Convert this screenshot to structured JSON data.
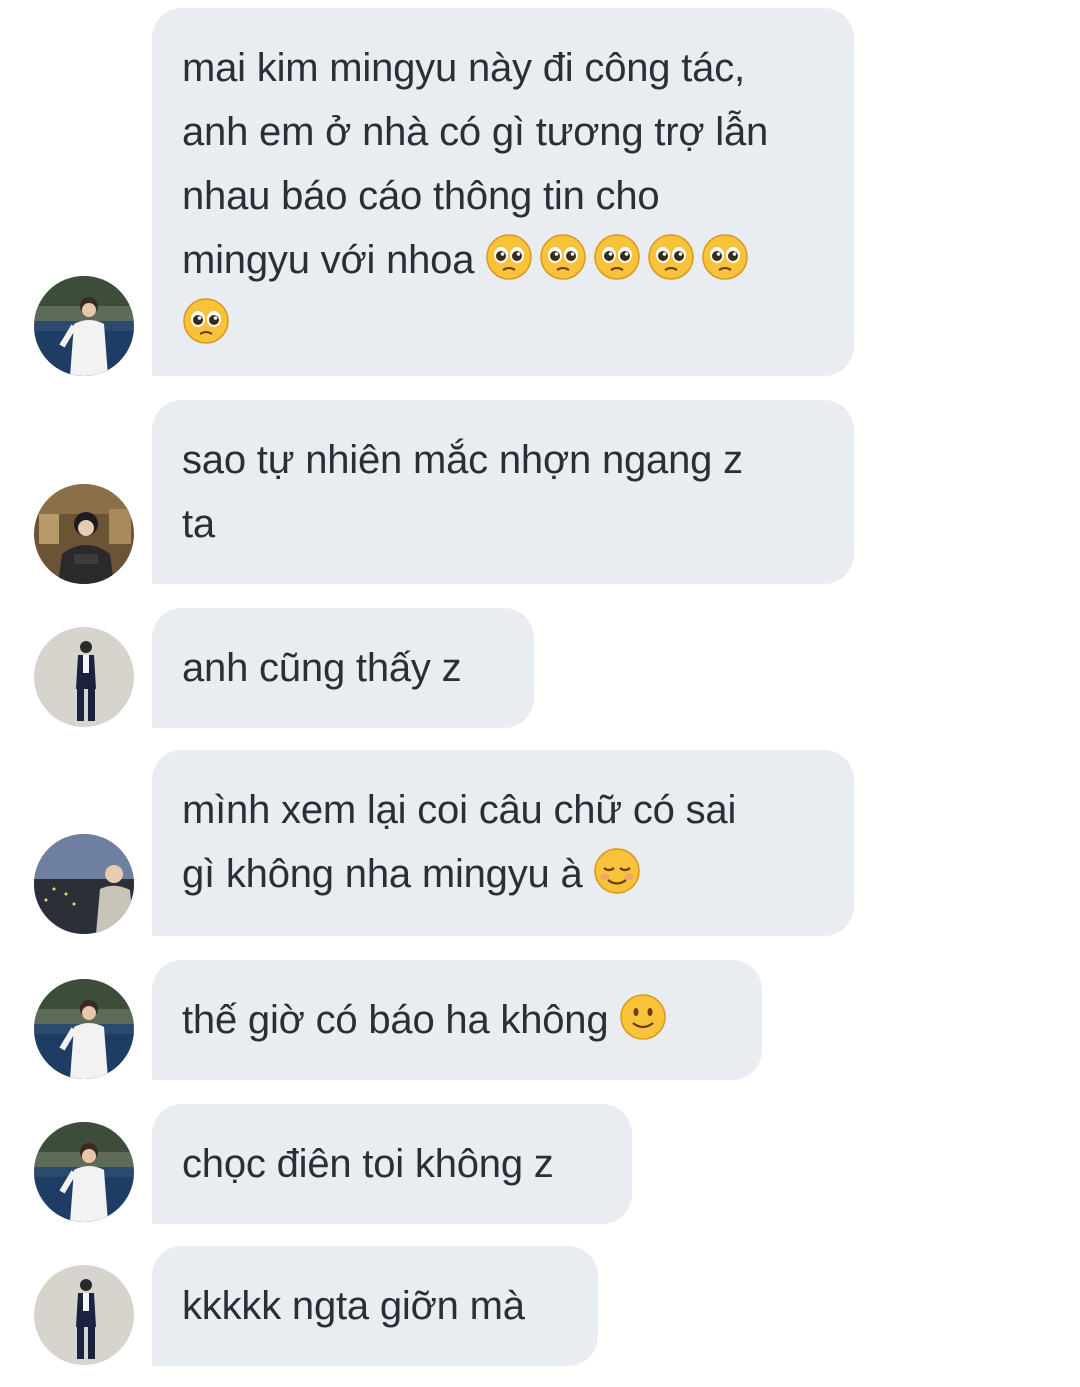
{
  "messages": [
    {
      "avatar": "avatar-sea-white-shirt",
      "text": "mai kim mingyu này đi công tác,\nanh em ở nhà có gì tương trợ lẫn\nnhau báo cáo thông tin cho\nmingyu với nhoa",
      "emojis": [
        "pleading-face-emoji",
        "pleading-face-emoji",
        "pleading-face-emoji",
        "pleading-face-emoji",
        "pleading-face-emoji",
        "pleading-face-emoji"
      ]
    },
    {
      "avatar": "avatar-cafe-hoodie",
      "text": "sao tự nhiên mắc nhợn ngang z\nta",
      "emojis": []
    },
    {
      "avatar": "avatar-suit-standing",
      "text": "anh cũng thấy z",
      "emojis": []
    },
    {
      "avatar": "avatar-city-night",
      "text": "mình xem lại coi câu chữ có sai\ngì không nha mingyu à",
      "emojis": [
        "relieved-smile-emoji"
      ]
    },
    {
      "avatar": "avatar-sea-white-shirt",
      "text": "thế giờ có báo ha không",
      "emojis": [
        "slight-smile-emoji"
      ]
    },
    {
      "avatar": "avatar-sea-white-shirt",
      "text": "chọc điên toi không z",
      "emojis": []
    },
    {
      "avatar": "avatar-suit-standing",
      "text": "kkkkk ngta giỡn mà",
      "emojis": []
    }
  ],
  "colors": {
    "bubble_bg": "#e9edf2",
    "text": "#2a2f36",
    "background": "#ffffff"
  }
}
